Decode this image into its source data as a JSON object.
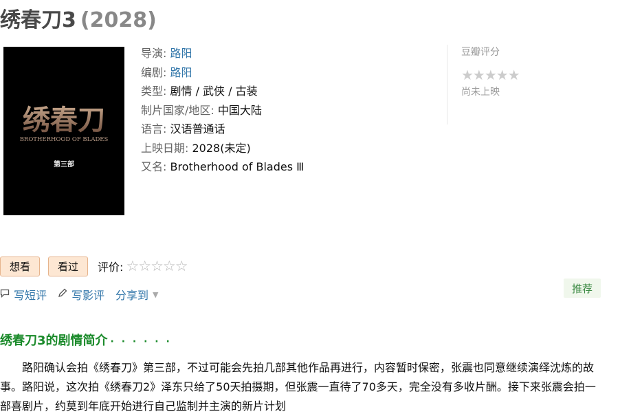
{
  "header": {
    "title": "绣春刀3",
    "year": "(2028)"
  },
  "poster": {
    "logo_cn": "绣春刀",
    "logo_en": "BROTHERHOOD OF BLADES",
    "part": "第三部"
  },
  "info": {
    "director_label": "导演: ",
    "director": "路阳",
    "writer_label": "编剧: ",
    "writer": "路阳",
    "genre_label": "类型: ",
    "genre": "剧情 / 武侠 / 古装",
    "country_label": "制片国家/地区: ",
    "country": "中国大陆",
    "language_label": "语言: ",
    "language": "汉语普通话",
    "release_label": "上映日期: ",
    "release": "2028(未定)",
    "aka_label": "又名: ",
    "aka": "Brotherhood of Blades Ⅲ"
  },
  "rating": {
    "title": "豆瓣评分",
    "stars": "★★★★★",
    "status": "尚未上映"
  },
  "actions": {
    "want_label": "想看",
    "seen_label": "看过",
    "rate_label": "评价:",
    "rate_stars": "☆☆☆☆☆"
  },
  "social": {
    "short_review": "写短评",
    "review": "写影评",
    "share": "分享到",
    "short_review_icon": "comment-icon",
    "review_icon": "pencil-icon",
    "share_caret": "▼"
  },
  "recommend_label": "推荐",
  "synopsis": {
    "title": "绣春刀3的剧情简介",
    "dots": "· · · · · ·",
    "text": "路阳确认会拍《绣春刀》第三部，不过可能会先拍几部其他作品再进行，内容暂时保密，张震也同意继续演绎沈炼的故事。路阳说，这次拍《绣春刀2》泽东只给了50天拍摄期，但张震一直待了70多天，完全没有多收片酬。接下来张震会拍一部喜剧片，约莫到年底开始进行自己监制并主演的新片计划"
  },
  "colors": {
    "link": "#3377aa",
    "green": "#1a8a2a",
    "button_bg": "#fde7d3",
    "button_border": "#e6b48d"
  }
}
